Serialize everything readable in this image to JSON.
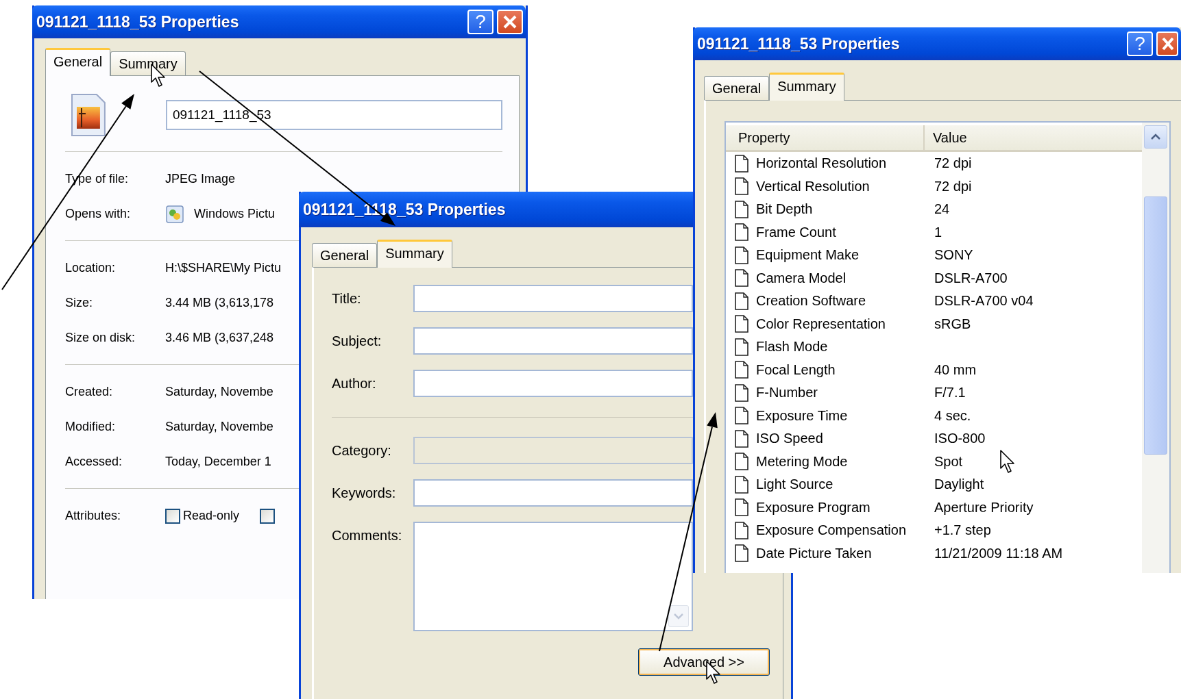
{
  "general_window": {
    "title": "091121_1118_53 Properties",
    "help_button": "?",
    "tabs": [
      {
        "label": "General",
        "selected": true
      },
      {
        "label": "Summary",
        "selected": false
      }
    ],
    "file_name": "091121_1118_53",
    "groups": [
      {
        "rows": [
          {
            "label": "Type of file:",
            "value": "JPEG Image",
            "kind": "text"
          },
          {
            "label": "Opens with:",
            "value": "Windows Pictu",
            "kind": "app"
          }
        ]
      },
      {
        "rows": [
          {
            "label": "Location:",
            "value": "H:\\$SHARE\\My Pictu",
            "kind": "text"
          },
          {
            "label": "Size:",
            "value": "3.44 MB (3,613,178",
            "kind": "text"
          },
          {
            "label": "Size on disk:",
            "value": "3.46 MB (3,637,248",
            "kind": "text"
          }
        ]
      },
      {
        "rows": [
          {
            "label": "Created:",
            "value": "Saturday, Novembe",
            "kind": "text"
          },
          {
            "label": "Modified:",
            "value": "Saturday, Novembe",
            "kind": "text"
          },
          {
            "label": "Accessed:",
            "value": "Today, December 1",
            "kind": "text"
          }
        ]
      }
    ],
    "attributes": {
      "label": "Attributes:",
      "checkboxes": [
        {
          "label": "Read-only",
          "checked": false
        },
        {
          "checked": false
        }
      ]
    }
  },
  "summary_window": {
    "title": "091121_1118_53 Properties",
    "tabs": [
      {
        "label": "General",
        "selected": false
      },
      {
        "label": "Summary",
        "selected": true
      }
    ],
    "field_groups": [
      {
        "fields": [
          {
            "label": "Title:",
            "kind": "line",
            "disabled": false
          },
          {
            "label": "Subject:",
            "kind": "line",
            "disabled": false
          },
          {
            "label": "Author:",
            "kind": "line",
            "disabled": false
          }
        ]
      },
      {
        "fields": [
          {
            "label": "Category:",
            "kind": "line",
            "disabled": true
          },
          {
            "label": "Keywords:",
            "kind": "line",
            "disabled": false
          },
          {
            "label": "Comments:",
            "kind": "multiline",
            "disabled": false
          }
        ]
      }
    ],
    "button": "Advanced >>"
  },
  "advanced_window": {
    "title": "091121_1118_53 Properties",
    "help_button": "?",
    "tabs": [
      {
        "label": "General",
        "selected": false
      },
      {
        "label": "Summary",
        "selected": true
      }
    ],
    "columns": [
      "Property",
      "Value"
    ],
    "rows": [
      {
        "property": "Horizontal Resolution",
        "value": "72 dpi"
      },
      {
        "property": "Vertical Resolution",
        "value": "72 dpi"
      },
      {
        "property": "Bit Depth",
        "value": "24"
      },
      {
        "property": "Frame Count",
        "value": "1"
      },
      {
        "property": "Equipment Make",
        "value": "SONY"
      },
      {
        "property": "Camera Model",
        "value": "DSLR-A700"
      },
      {
        "property": "Creation Software",
        "value": "DSLR-A700 v04"
      },
      {
        "property": "Color Representation",
        "value": "sRGB"
      },
      {
        "property": "Flash Mode"
      },
      {
        "property": "Focal Length",
        "value": "40 mm"
      },
      {
        "property": "F-Number",
        "value": "F/7.1"
      },
      {
        "property": "Exposure Time",
        "value": "4 sec."
      },
      {
        "property": "ISO Speed",
        "value": "ISO-800"
      },
      {
        "property": "Metering Mode",
        "value": "Spot"
      },
      {
        "property": "Light Source",
        "value": "Daylight"
      },
      {
        "property": "Exposure Program",
        "value": "Aperture Priority"
      },
      {
        "property": "Exposure Compensation",
        "value": "+1.7 step"
      },
      {
        "property": "Date Picture Taken",
        "value": "11/21/2009 11:18 AM"
      }
    ]
  }
}
